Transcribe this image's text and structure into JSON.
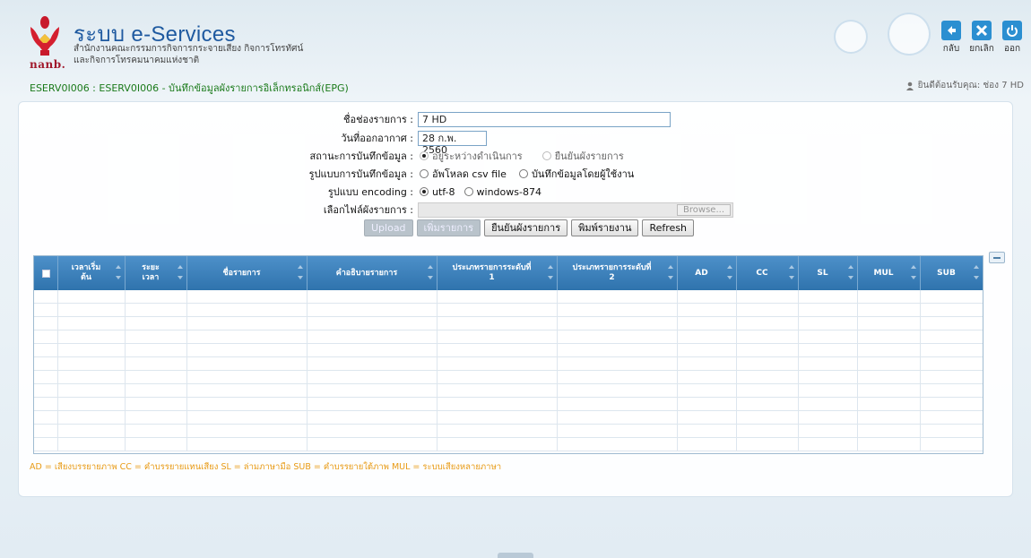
{
  "header": {
    "logo_text": "nanb.",
    "system_title": "ระบบ e-Services",
    "subtitle_line1": "สำนักงานคณะกรรมการกิจการกระจายเสียง กิจการโทรทัศน์",
    "subtitle_line2": "และกิจการโทรคมนาคมแห่งชาติ",
    "breadcrumb": "ESERV0I006 : ESERV0I006 - บันทึกข้อมูลผังรายการอิเล็กทรอนิกส์(EPG)",
    "welcome": "ยินดีต้อนรับคุณ: ช่อง 7 HD",
    "buttons": {
      "back": "กลับ",
      "cancel": "ยกเลิก",
      "logout": "ออก"
    },
    "colors": {
      "back": "#2b8fd1",
      "cancel": "#2b8fd1",
      "logout": "#2b8fd1"
    }
  },
  "form": {
    "channel_label": "ชื่อช่องรายการ :",
    "channel_value": "7 HD",
    "date_label": "วันที่ออกอากาศ :",
    "date_value": "28 ก.พ. 2560",
    "status_label": "สถานะการบันทึกข้อมูล :",
    "status_options": [
      "อยู่ระหว่างดำเนินการ",
      "ยืนยันผังรายการ"
    ],
    "format_label": "รูปแบบการบันทึกข้อมูล :",
    "format_options": [
      "อัพโหลด csv file",
      "บันทึกข้อมูลโดยผู้ใช้งาน"
    ],
    "encoding_label": "รูปแบบ encoding :",
    "encoding_options": [
      "utf-8",
      "windows-874"
    ],
    "file_label": "เลือกไฟล์ผังรายการ :",
    "browse_label": "Browse...",
    "buttons": {
      "upload": "Upload",
      "add_program": "เพิ่มรายการ",
      "confirm": "ยืนยันผังรายการ",
      "print": "พิมพ์รายงาน",
      "refresh": "Refresh"
    }
  },
  "table": {
    "columns": [
      "เวลาเริ่มต้น",
      "ระยะเวลา",
      "ชื่อรายการ",
      "คำอธิบายรายการ",
      "ประเภทรายการระดับที่ 1",
      "ประเภทรายการระดับที่ 2",
      "AD",
      "CC",
      "SL",
      "MUL",
      "SUB"
    ],
    "column_head_1": "เวลาเริ่ม",
    "column_head_1b": "ต้น",
    "column_head_2": "ระยะ",
    "column_head_2b": "เวลา",
    "column_head_5": "ประเภทรายการระดับที่",
    "column_head_5b": "1",
    "column_head_6": "ประเภทรายการระดับที่",
    "column_head_6b": "2",
    "rows": []
  },
  "legend": "AD = เสียงบรรยายภาพ CC = คำบรรยายแทนเสียง SL = ล่ามภาษามือ SUB = คำบรรยายใต้ภาพ MUL = ระบบเสียงหลายภาษา"
}
